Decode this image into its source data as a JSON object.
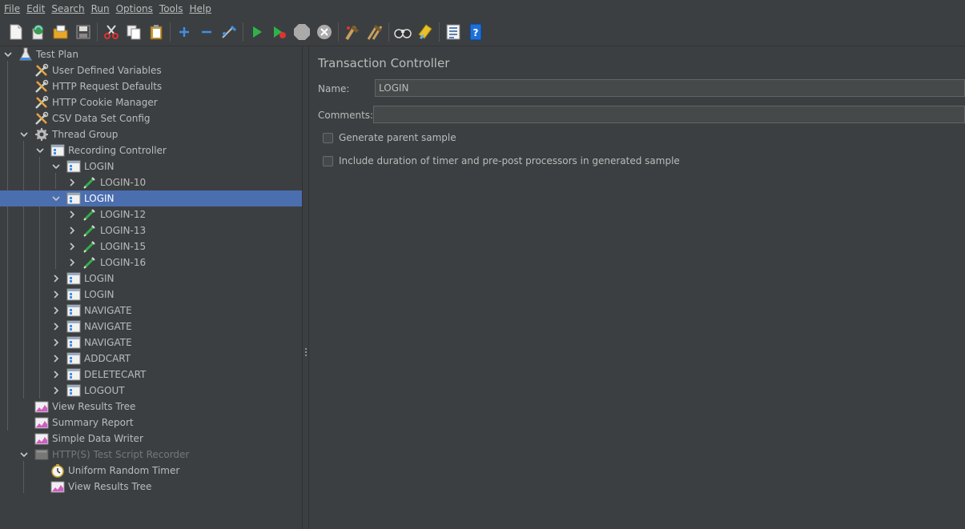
{
  "menu": [
    "File",
    "Edit",
    "Search",
    "Run",
    "Options",
    "Tools",
    "Help"
  ],
  "toolbar": [
    {
      "name": "new-icon"
    },
    {
      "name": "templates-icon"
    },
    {
      "name": "open-icon"
    },
    {
      "name": "save-icon"
    },
    {
      "sep": true
    },
    {
      "name": "cut-icon"
    },
    {
      "name": "copy-icon"
    },
    {
      "name": "paste-icon"
    },
    {
      "sep": true
    },
    {
      "name": "expand-all-icon"
    },
    {
      "name": "collapse-all-icon"
    },
    {
      "name": "toggle-icon"
    },
    {
      "sep": true
    },
    {
      "name": "start-icon"
    },
    {
      "name": "start-no-pauses-icon"
    },
    {
      "name": "stop-icon"
    },
    {
      "name": "shutdown-icon"
    },
    {
      "sep": true
    },
    {
      "name": "clear-icon"
    },
    {
      "name": "clear-all-icon"
    },
    {
      "sep": true
    },
    {
      "name": "search-icon"
    },
    {
      "name": "reset-search-icon"
    },
    {
      "sep": true
    },
    {
      "name": "function-helper-icon"
    },
    {
      "name": "help-icon"
    }
  ],
  "tree": [
    {
      "label": "Test Plan",
      "icon": "test-plan-icon",
      "level": 0,
      "toggle": "expanded"
    },
    {
      "label": "User Defined Variables",
      "icon": "config-element-icon",
      "level": 1,
      "toggle": "none"
    },
    {
      "label": "HTTP Request Defaults",
      "icon": "config-element-icon",
      "level": 1,
      "toggle": "none"
    },
    {
      "label": "HTTP Cookie Manager",
      "icon": "config-element-icon",
      "level": 1,
      "toggle": "none"
    },
    {
      "label": "CSV Data Set Config",
      "icon": "config-element-icon",
      "level": 1,
      "toggle": "none"
    },
    {
      "label": "Thread Group",
      "icon": "thread-group-icon",
      "level": 1,
      "toggle": "expanded"
    },
    {
      "label": "Recording Controller",
      "icon": "controller-icon",
      "level": 2,
      "toggle": "expanded"
    },
    {
      "label": "LOGIN",
      "icon": "controller-icon",
      "level": 3,
      "toggle": "expanded"
    },
    {
      "label": "LOGIN-10",
      "icon": "sampler-icon",
      "level": 4,
      "toggle": "collapsed"
    },
    {
      "label": "LOGIN",
      "icon": "controller-icon",
      "level": 3,
      "toggle": "expanded",
      "selected": true
    },
    {
      "label": "LOGIN-12",
      "icon": "sampler-icon",
      "level": 4,
      "toggle": "collapsed"
    },
    {
      "label": "LOGIN-13",
      "icon": "sampler-icon",
      "level": 4,
      "toggle": "collapsed"
    },
    {
      "label": "LOGIN-15",
      "icon": "sampler-icon",
      "level": 4,
      "toggle": "collapsed"
    },
    {
      "label": "LOGIN-16",
      "icon": "sampler-icon",
      "level": 4,
      "toggle": "collapsed"
    },
    {
      "label": "LOGIN",
      "icon": "controller-icon",
      "level": 3,
      "toggle": "collapsed"
    },
    {
      "label": "LOGIN",
      "icon": "controller-icon",
      "level": 3,
      "toggle": "collapsed"
    },
    {
      "label": "NAVIGATE",
      "icon": "controller-icon",
      "level": 3,
      "toggle": "collapsed"
    },
    {
      "label": "NAVIGATE",
      "icon": "controller-icon",
      "level": 3,
      "toggle": "collapsed"
    },
    {
      "label": "NAVIGATE",
      "icon": "controller-icon",
      "level": 3,
      "toggle": "collapsed"
    },
    {
      "label": "ADDCART",
      "icon": "controller-icon",
      "level": 3,
      "toggle": "collapsed"
    },
    {
      "label": "DELETECART",
      "icon": "controller-icon",
      "level": 3,
      "toggle": "collapsed"
    },
    {
      "label": "LOGOUT",
      "icon": "controller-icon",
      "level": 3,
      "toggle": "collapsed"
    },
    {
      "label": "View Results Tree",
      "icon": "listener-icon",
      "level": 1,
      "toggle": "none"
    },
    {
      "label": "Summary Report",
      "icon": "listener-icon",
      "level": 1,
      "toggle": "none"
    },
    {
      "label": "Simple Data Writer",
      "icon": "listener-icon",
      "level": 1,
      "toggle": "none"
    },
    {
      "label": "HTTP(S) Test Script Recorder",
      "icon": "recorder-icon",
      "level": 1,
      "toggle": "expanded",
      "disabled": true
    },
    {
      "label": "Uniform Random Timer",
      "icon": "timer-icon",
      "level": 2,
      "toggle": "none"
    },
    {
      "label": "View Results Tree",
      "icon": "listener-icon",
      "level": 2,
      "toggle": "none"
    }
  ],
  "editor": {
    "title": "Transaction Controller",
    "name_label": "Name:",
    "name_value": "LOGIN",
    "comments_label": "Comments:",
    "comments_value": "",
    "checkbox_parent_sample": {
      "label": "Generate parent sample",
      "checked": false
    },
    "checkbox_include_timers": {
      "label": "Include duration of timer and pre-post processors in generated sample",
      "checked": false
    }
  },
  "colors": {
    "background": "#3c3f41",
    "selection": "#4b6eaf",
    "input": "#45494a"
  }
}
